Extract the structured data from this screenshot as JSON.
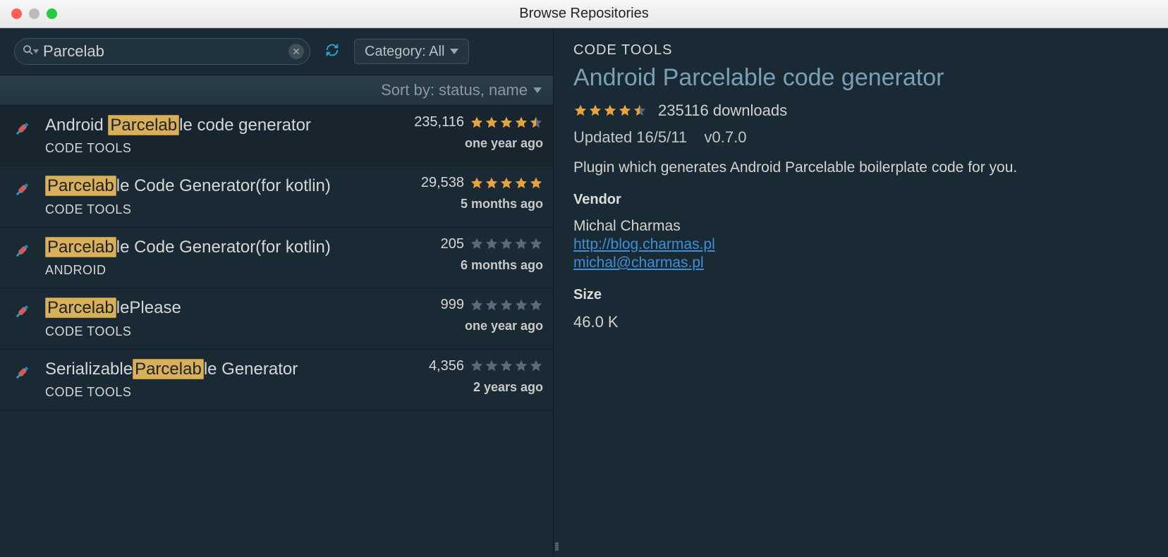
{
  "window": {
    "title": "Browse Repositories"
  },
  "toolbar": {
    "search_value": "Parcelab",
    "category_label": "Category: All"
  },
  "sort": {
    "label": "Sort by: status, name"
  },
  "results": [
    {
      "pre": "Android ",
      "hl": "Parcelab",
      "post": "le code generator",
      "category": "CODE TOOLS",
      "downloads": "235,116",
      "rating": 4.5,
      "ago": "one year ago",
      "selected": true
    },
    {
      "pre": "",
      "hl": "Parcelab",
      "post": "le Code Generator(for kotlin)",
      "category": "CODE TOOLS",
      "downloads": "29,538",
      "rating": 5,
      "ago": "5 months ago",
      "selected": false
    },
    {
      "pre": "",
      "hl": "Parcelab",
      "post": "le Code Generator(for kotlin)",
      "category": "ANDROID",
      "downloads": "205",
      "rating": 0,
      "ago": "6 months ago",
      "selected": false
    },
    {
      "pre": "",
      "hl": "Parcelab",
      "post": "lePlease",
      "category": "CODE TOOLS",
      "downloads": "999",
      "rating": 0,
      "ago": "one year ago",
      "selected": false
    },
    {
      "pre": "Serializable",
      "hl": "Parcelab",
      "post": "le Generator",
      "category": "CODE TOOLS",
      "downloads": "4,356",
      "rating": 0,
      "ago": "2 years ago",
      "selected": false
    }
  ],
  "detail": {
    "category": "CODE TOOLS",
    "title": "Android Parcelable code generator",
    "rating": 4.5,
    "downloads": "235116 downloads",
    "updated": "Updated 16/5/11",
    "version": "v0.7.0",
    "description": "Plugin which generates Android Parcelable boilerplate code for you.",
    "vendor_heading": "Vendor",
    "vendor_name": "Michal Charmas",
    "vendor_url": "http://blog.charmas.pl",
    "vendor_email": "michal@charmas.pl",
    "size_heading": "Size",
    "size_value": "46.0 K"
  }
}
